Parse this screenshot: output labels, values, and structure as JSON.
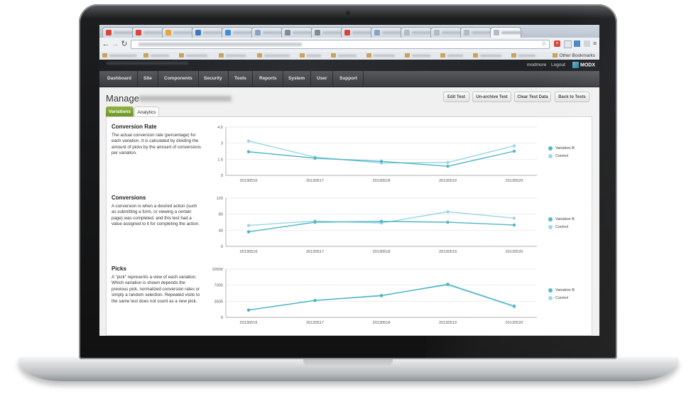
{
  "browser": {
    "tab_favicons": [
      "#d9443b",
      "#d9443b",
      "#e8a33d",
      "#3c79c4",
      "#3b8fe0",
      "#8aa2c1",
      "#7b8ba0",
      "#7e8a99",
      "#d9443b",
      "#8aa2c1",
      "#b2bac4",
      "#b2bac4",
      "#b2bac4",
      "#b2bac4"
    ],
    "other_bookmarks": "Other Bookmarks",
    "icons": {
      "back": "back-arrow-icon",
      "forward": "forward-arrow-icon",
      "reload": "reload-icon",
      "star": "star-icon"
    }
  },
  "manager": {
    "username": "modmore",
    "logout": "Logout",
    "brand": "MODX",
    "nav": [
      "Dashboard",
      "Site",
      "Components",
      "Security",
      "Tools",
      "Reports",
      "System",
      "User",
      "Support"
    ]
  },
  "page": {
    "title": "Manage",
    "buttons": [
      "Edit Test",
      "Un-archive Test",
      "Clear Test Data",
      "Back to Tests"
    ],
    "tabs": [
      "Variations",
      "Analytics"
    ],
    "active_tab": "Variations"
  },
  "sections": [
    {
      "title": "Conversion Rate",
      "description": "The actual conversion rate (percentage) for each variation. It is calculated by dividing the amount of picks by the amount of conversions per variation."
    },
    {
      "title": "Conversions",
      "description": "A conversion is when a desired action (such as submitting a form, or viewing a certain page) was completed, and this test had a value assigned to it for completing the action."
    },
    {
      "title": "Picks",
      "description": "A \"pick\" represents a view of each variation. Which variation is shown depends the previous pick, normalized conversion rates or simply a random selection. Repeated visits to the same test does not count as a new pick."
    }
  ],
  "colors": {
    "variation_b": "#4cb6c4",
    "control": "#9ad6e4",
    "grid": "#e3e3e3",
    "axis": "#999999"
  },
  "chart_data": [
    {
      "type": "line",
      "title": "Conversion Rate",
      "x": [
        "20130516",
        "20130517",
        "20130518",
        "20130519",
        "20130520"
      ],
      "ylim": [
        0,
        4.5
      ],
      "yticks": [
        "0",
        "1.5",
        "3",
        "4.5"
      ],
      "series": [
        {
          "name": "Variation B",
          "values": [
            2.2,
            1.6,
            1.3,
            0.85,
            2.25
          ]
        },
        {
          "name": "Control",
          "values": [
            3.2,
            1.7,
            1.15,
            1.2,
            2.75
          ]
        }
      ],
      "legend": "right",
      "grid": true
    },
    {
      "type": "line",
      "title": "Conversions",
      "x": [
        "20130516",
        "20130517",
        "20130518",
        "20130519",
        "20130520"
      ],
      "ylim": [
        0,
        120
      ],
      "yticks": [
        "0",
        "40",
        "80",
        "120"
      ],
      "series": [
        {
          "name": "Variation B",
          "values": [
            36,
            60,
            62,
            60,
            53
          ]
        },
        {
          "name": "Control",
          "values": [
            52,
            63,
            58,
            86,
            70
          ]
        }
      ],
      "legend": "right",
      "grid": true
    },
    {
      "type": "line",
      "title": "Picks",
      "x": [
        "20130516",
        "20130517",
        "20130518",
        "20130519",
        "20130520"
      ],
      "ylim": [
        0,
        10500
      ],
      "yticks": [
        "0",
        "3500",
        "7000",
        "10500"
      ],
      "series": [
        {
          "name": "Variation B",
          "values": [
            1600,
            3650,
            4700,
            7200,
            2450
          ]
        },
        {
          "name": "Control",
          "values": [
            1550,
            3700,
            4800,
            7050,
            2300
          ]
        }
      ],
      "legend": "right",
      "grid": true
    }
  ]
}
